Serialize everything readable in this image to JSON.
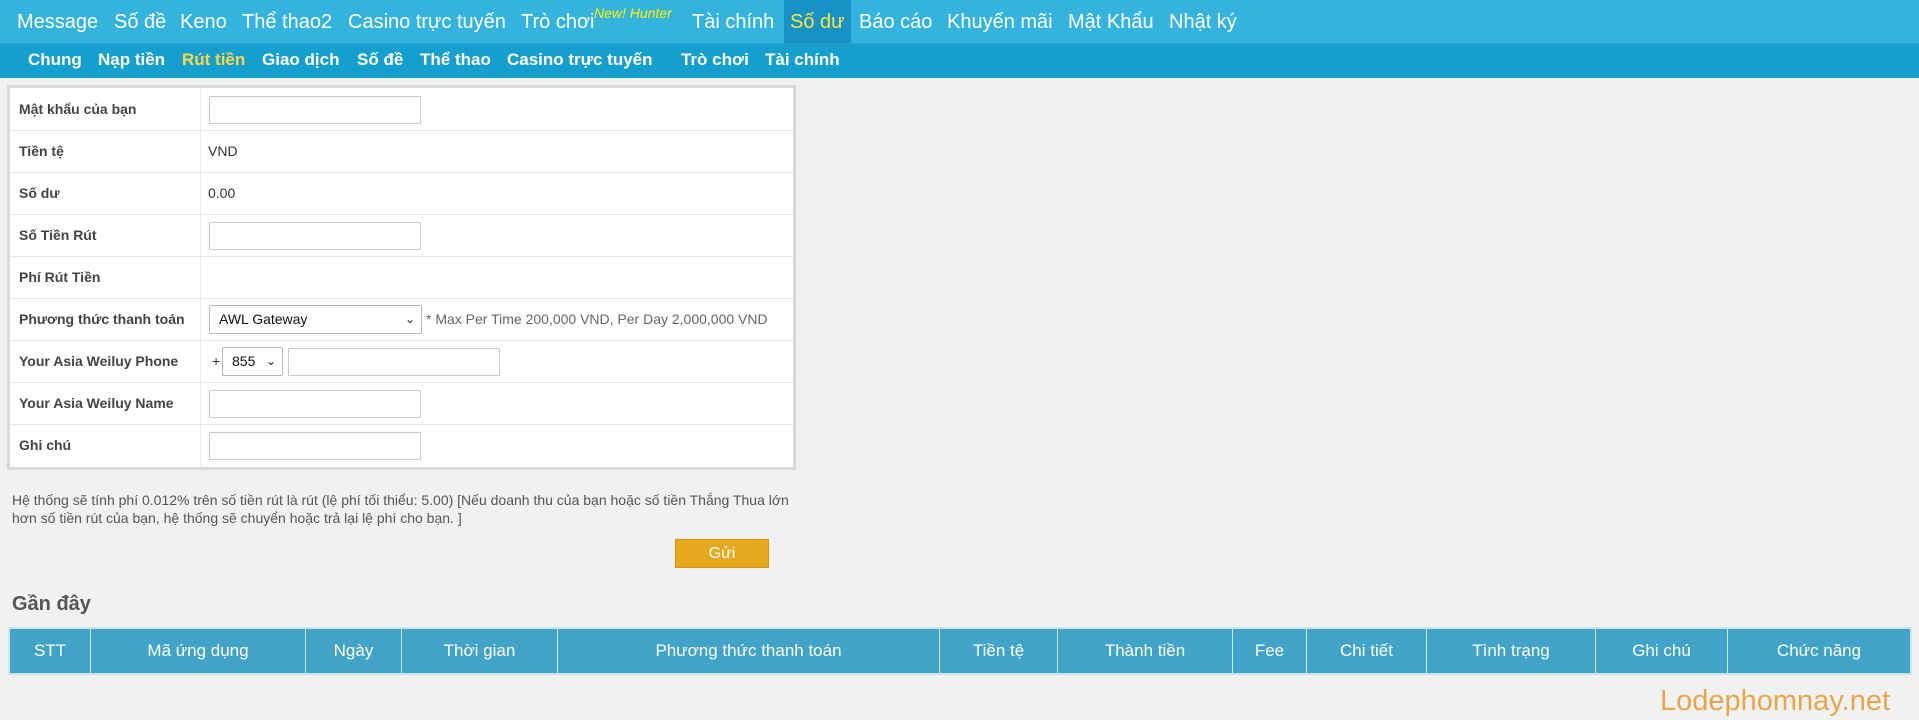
{
  "top_nav": [
    "Message",
    "Số đề",
    "Keno",
    "Thể thao2",
    "Casino trực tuyến",
    "Trò chơi",
    "Tài chính",
    "Số dư",
    "Báo cáo",
    "Khuyến mãi",
    "Mật Khẩu",
    "Nhật ký"
  ],
  "top_nav_badge": "New! Hunter",
  "top_nav_active": "Số dư",
  "sub_nav": [
    "Chung",
    "Nạp tiền",
    "Rút tiền",
    "Giao dịch",
    "Số đề",
    "Thể thao",
    "Casino trực tuyến",
    "Trò chơi",
    "Tài chính"
  ],
  "sub_nav_active": "Rút tiền",
  "form": {
    "password_label": "Mật khẩu của bạn",
    "currency_label": "Tiền tệ",
    "currency_value": "VND",
    "balance_label": "Số dư",
    "balance_value": "0.00",
    "amount_label": "Số Tiền Rút",
    "fee_label": "Phí Rút Tiền",
    "method_label": "Phương thức thanh toán",
    "method_value": "AWL Gateway",
    "method_note": "* Max Per Time 200,000 VND, Per Day 2,000,000 VND",
    "phone_label": "Your Asia Weiluy Phone",
    "phone_prefix": "+",
    "phone_code": "855",
    "name_label": "Your Asia Weiluy Name",
    "note_label": "Ghi chú"
  },
  "info_text": "Hệ thống sẽ tính phí 0.012% trên số tiền rút là rút (lệ phí tối thiểu: 5.00) [Nếu doanh thu của bạn hoặc số tiền Thắng Thua lớn hơn số tiền rút của bạn, hệ thống sẽ chuyển hoặc trả lại lệ phí cho bạn. ]",
  "submit_label": "Gửi",
  "recent_title": "Gần đây",
  "table_headers": [
    "STT",
    "Mã ứng dụng",
    "Ngày",
    "Thời gian",
    "Phương thức thanh toán",
    "Tiền tệ",
    "Thành tiền",
    "Fee",
    "Chi tiết",
    "Tình trạng",
    "Ghi chú",
    "Chức năng"
  ],
  "watermark": "Lodephomnay.net",
  "colors": {
    "top_nav": "#35b3df",
    "sub_nav": "#159fcf",
    "active_text": "#ffe14a",
    "submit": "#e6a91d",
    "table_header": "#42a3c8",
    "badge": "#fff200"
  }
}
